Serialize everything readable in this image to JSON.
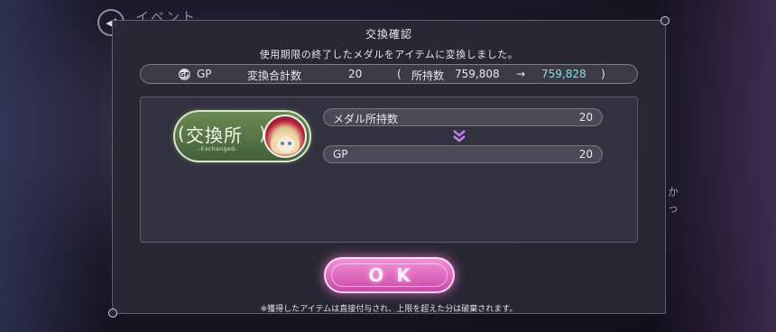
{
  "background": {
    "title": "イベント",
    "side_texts": [
      "か",
      "っ"
    ]
  },
  "dialog": {
    "title": "交換確認",
    "message": "使用期限の終了したメダルをアイテムに変換しました。",
    "summary": {
      "currency_icon": "gp-coin-icon",
      "currency": "GP",
      "total_label": "変換合計数",
      "total_value": "20",
      "open_paren": "(",
      "owned_label": "所持数",
      "owned_before": "759,808",
      "arrow": "→",
      "owned_after": "759,828",
      "close_paren": ")"
    },
    "shop": {
      "label": "交換所",
      "sub_label": "-Exchanged-",
      "bracket_left": "(",
      "bracket_right": ")"
    },
    "conversion": {
      "from_label": "メダル所持数",
      "from_value": "20",
      "arrow_icon": "double-chevron-down-icon",
      "to_label": "GP",
      "to_value": "20"
    },
    "ok_label": "OK",
    "note": "※獲得したアイテムは直接付与され、上限を超えた分は破棄されます。"
  },
  "colors": {
    "accent_pink": "#f48fd8",
    "highlight_cyan": "#7fe3e0",
    "shop_green": "#6c8a52",
    "arrow_purple": "#c27cf0"
  }
}
